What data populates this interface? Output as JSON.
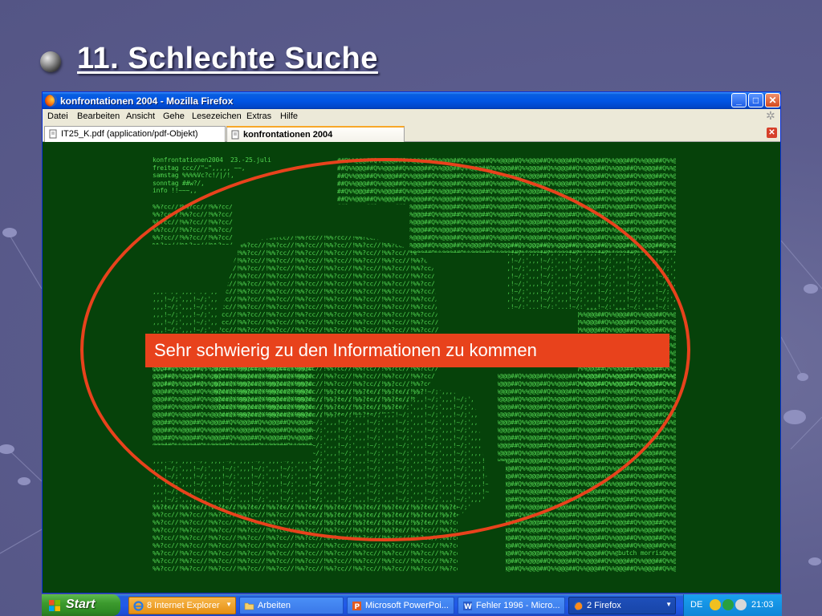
{
  "slide": {
    "title": "11. Schlechte Suche",
    "callout": "Sehr schwierig zu den Informationen zu kommen"
  },
  "browser": {
    "window_title": "konfrontationen 2004 - Mozilla Firefox",
    "menu": [
      "Datei",
      "Bearbeiten",
      "Ansicht",
      "Gehe",
      "Lesezeichen",
      "Extras",
      "Hilfe"
    ],
    "tabs": [
      {
        "label": "IT25_K.pdf (application/pdf-Objekt)",
        "active": false
      },
      {
        "label": "konfrontationen 2004",
        "active": true
      }
    ],
    "page_text_lines": [
      "konfrontationen2004  23.-25.juli",
      "freitag ccc//\"~\",,,,, ~~,",
      "samstag %%%%Vc?c!/|/!,",
      "sonntag ##w?/,",
      "info !!~~~,,",
      "butch morris"
    ],
    "background_color": "#06420a",
    "text_color": "#52d651"
  },
  "taskbar": {
    "start_label": "Start",
    "tasks": [
      {
        "label": "8 Internet Explorer",
        "icon": "ie-icon",
        "group": true
      },
      {
        "label": "Arbeiten",
        "icon": "folder-icon"
      },
      {
        "label": "Microsoft PowerPoi...",
        "icon": "powerpoint-icon"
      },
      {
        "label": "Fehler 1996 - Micro...",
        "icon": "word-icon"
      },
      {
        "label": "2 Firefox",
        "icon": "firefox-icon",
        "active": true
      }
    ],
    "language": "DE",
    "clock": "21:03"
  },
  "colors": {
    "highlight": "#e8421c",
    "slide_background": "#5c5d8e"
  }
}
